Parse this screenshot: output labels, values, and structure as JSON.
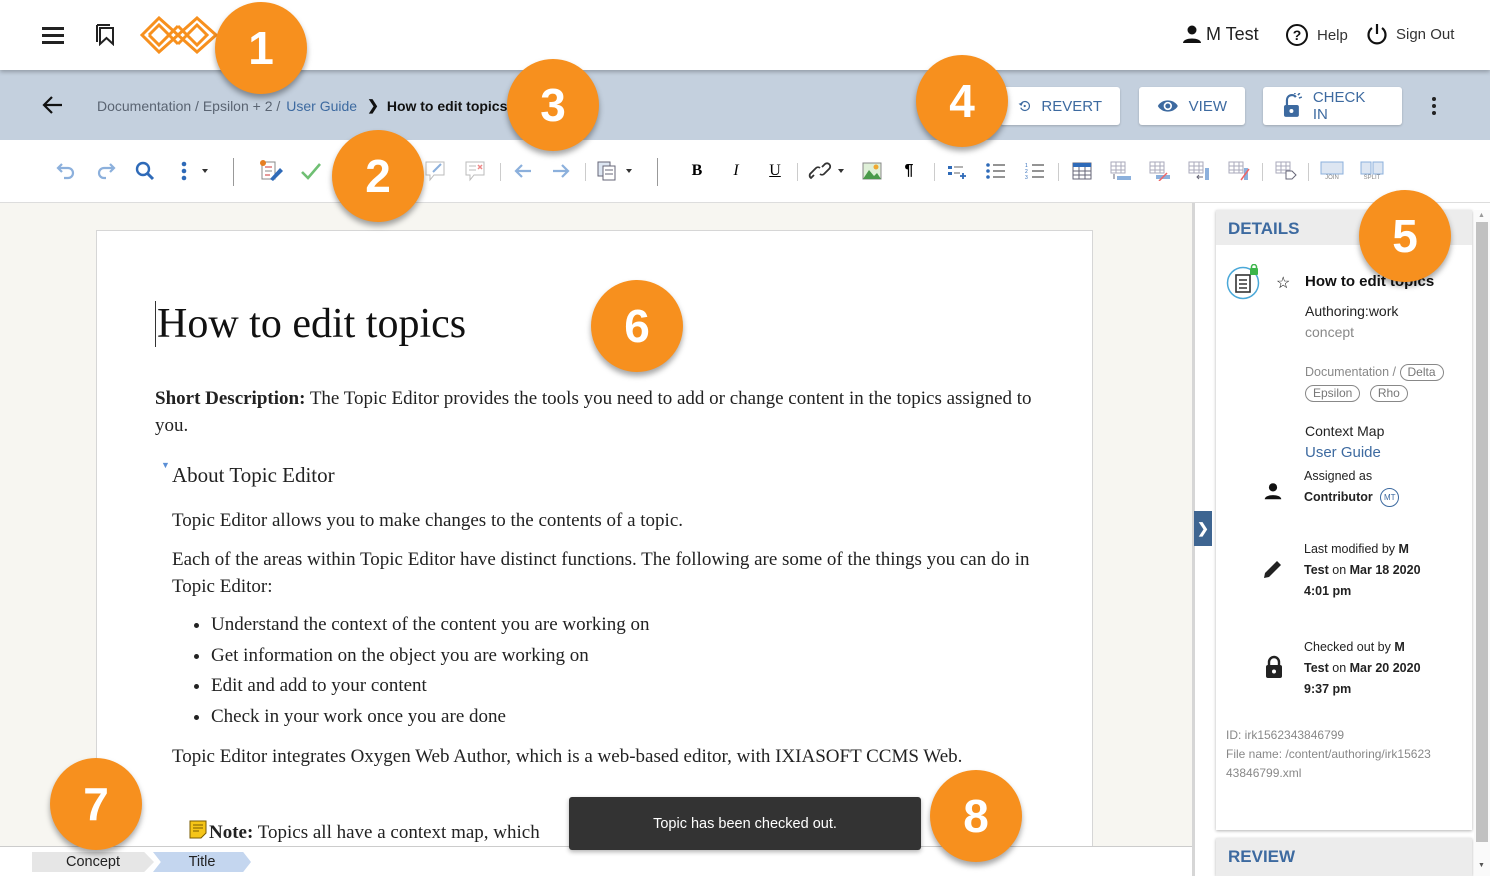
{
  "topbar": {
    "user_name": "M Test",
    "help_label": "Help",
    "signout_label": "Sign Out",
    "brand_color": "#f7901e"
  },
  "breadcrumb": {
    "path_prefix": "Documentation / Epsilon + 2 /",
    "link": "User Guide",
    "current": "How to edit topics"
  },
  "actions": {
    "revert_label": "REVERT",
    "view_label": "VIEW",
    "checkin_label": "CHECK IN"
  },
  "toolbar": {
    "join_label": "JOIN",
    "split_label": "SPLIT",
    "bold_label": "B",
    "italic_label": "I",
    "underline_label": "U",
    "pilcrow": "¶"
  },
  "document": {
    "title": "How to edit topics",
    "shortdesc_label": "Short Description:",
    "shortdesc_text": " The Topic Editor provides the tools you need to add or change content in the topics assigned to you.",
    "section_title": "About Topic Editor",
    "para1": "Topic Editor allows you to make changes to the contents of a topic.",
    "para2": "Each of the areas within Topic Editor have distinct functions. The following are some of the things you can do in Topic Editor:",
    "bullets": [
      "Understand the context of the content you are working on",
      "Get information on the object you are working on",
      "Edit and add to your content",
      "Check in your work once you are done"
    ],
    "para3": "Topic Editor integrates Oxygen Web Author, which is a web-based editor, with IXIASOFT CCMS Web.",
    "note_label": "Note:",
    "note_text": " Topics all have a context map, which"
  },
  "details": {
    "header": "DETAILS",
    "title": "How to edit topics",
    "status": "Authoring:work",
    "type": "concept",
    "location_prefix": "Documentation /",
    "tags": [
      "Delta",
      "Epsilon",
      "Rho"
    ],
    "context_map_label": "Context Map",
    "context_map_value": "User Guide",
    "assigned_label": "Assigned as",
    "assigned_role": "Contributor",
    "assigned_initials": "MT",
    "modified_prefix": "Last modified by ",
    "modified_user_a": "M",
    "modified_user_b": "Test",
    "modified_on": " on ",
    "modified_date": "Mar 18 2020",
    "modified_time": "4:01 pm",
    "checked_prefix": "Checked out by ",
    "checked_user_a": "M",
    "checked_user_b": "Test",
    "checked_on": " on ",
    "checked_date": "Mar 20 2020",
    "checked_time": "9:37 pm",
    "id_line": "ID: irk1562343846799",
    "file_line_1": "File name: /content/authoring/irk15623",
    "file_line_2": "43846799.xml"
  },
  "review": {
    "header": "REVIEW"
  },
  "statusbar": {
    "crumbs": [
      "Concept",
      "Title"
    ]
  },
  "toast": {
    "message": "Topic has been checked out."
  },
  "callouts": [
    "1",
    "2",
    "3",
    "4",
    "5",
    "6",
    "7",
    "8"
  ]
}
